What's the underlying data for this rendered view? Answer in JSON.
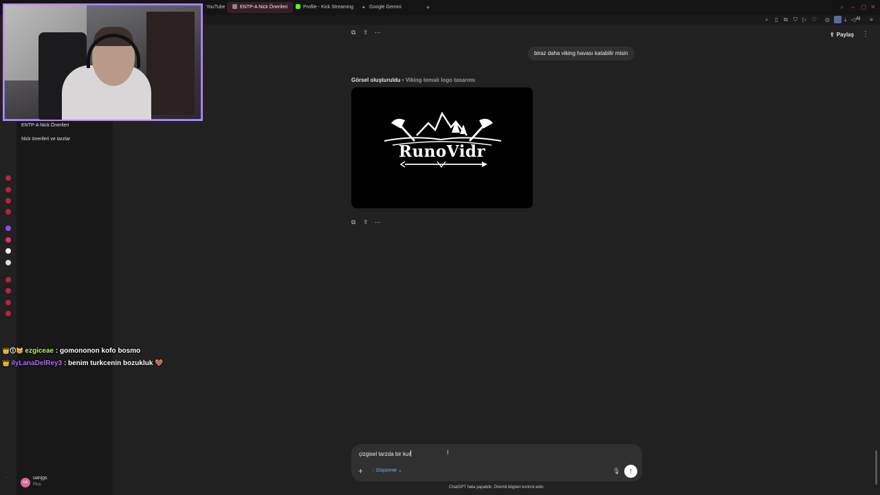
{
  "browser": {
    "tabs": [
      {
        "label": "YouTube",
        "active": false
      },
      {
        "label": "ENTP-A Nick Önerileri",
        "active": true
      },
      {
        "label": "Profile - Kick Streaming",
        "active": false
      },
      {
        "label": "Google Gemini",
        "active": false
      }
    ],
    "new_tab": "+",
    "ai_label": "AI"
  },
  "sidebar": {
    "items": [
      {
        "label": "ENTP-A Nick Önerileri"
      },
      {
        "label": "Nick önerileri ve tarzlar"
      }
    ],
    "user": {
      "initials": "UA",
      "name": "uanjgs",
      "plan": "Plus"
    }
  },
  "stream_chat": [
    {
      "badges": "👑⓵😸",
      "user": "ezgiceae",
      "user_color": "#b8f06a",
      "message": ": gomononon kofo bosmo"
    },
    {
      "badges": "👑",
      "user": "ilyLanaDelRey3",
      "user_color": "#b06aff",
      "message": ": benim turkcenin bozukluk",
      "emote": "🤎"
    }
  ],
  "header": {
    "share_label": "Paylaş"
  },
  "conversation": {
    "user_message": "biraz daha viking havası katabilir misin",
    "image_caption_strong": "Görsel oluşturuldu",
    "image_caption_sub": "• Viking temalı logo tasarımı",
    "image_logo_text": "RunoVidr"
  },
  "composer": {
    "input_value": "çizgisel tarzda bir kur",
    "thinking_label": "Düşünme",
    "footer": "ChatGPT hata yapabilir. Önemli bilgileri kontrol edin."
  },
  "colors": {
    "accent": "#c47cff",
    "background": "#212121",
    "sidebar": "#181818"
  }
}
